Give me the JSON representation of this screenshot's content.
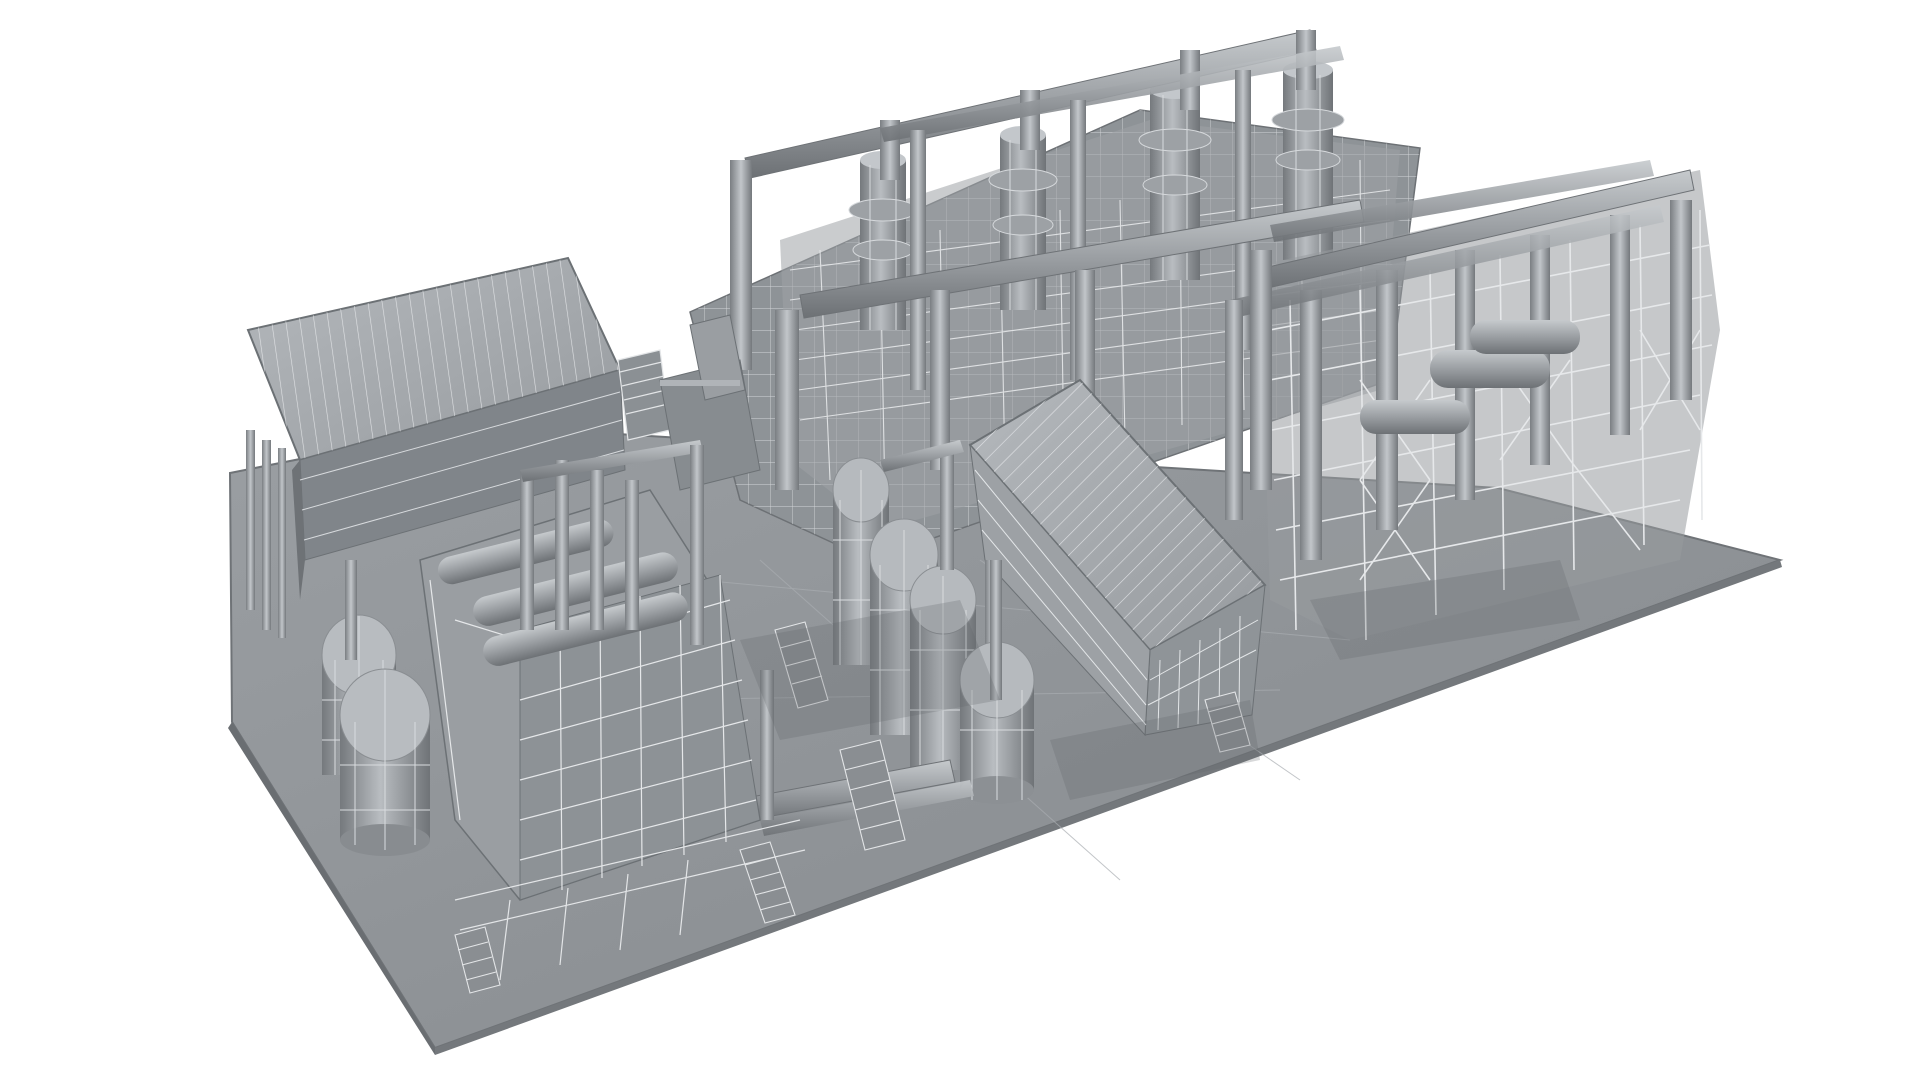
{
  "scene": {
    "subject": "industrial-plant-3d-model",
    "render_style": "clay-wireframe",
    "colors": {
      "background": "#ffffff",
      "ground": "#8f9397",
      "ground_edge": "#6f7377",
      "line": "#eef0f2",
      "metal_light": "#b3b7bb",
      "metal_mid": "#8d9296",
      "metal_dark": "#6c7175",
      "roof": "#a4a8ac",
      "shadow": "#55595d"
    }
  }
}
